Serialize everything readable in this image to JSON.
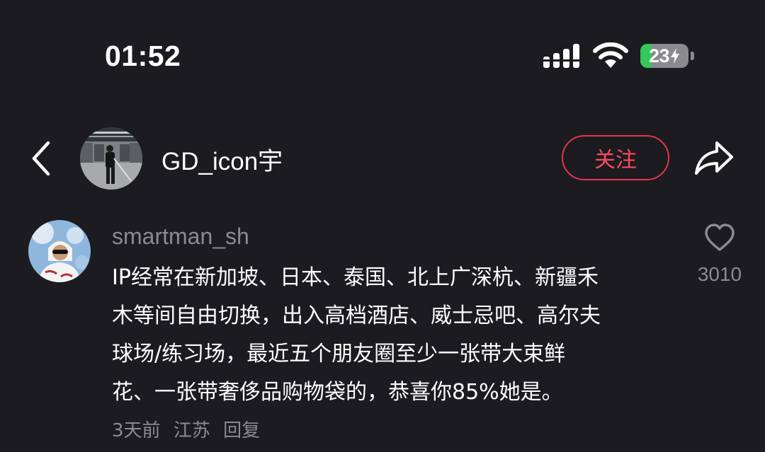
{
  "status_bar": {
    "time": "01:52",
    "battery_level": 23,
    "battery_text": "23",
    "charging": true,
    "icons": [
      "signal-icon",
      "wifi-icon",
      "battery-icon",
      "charging-bolt-icon"
    ]
  },
  "header": {
    "back_icon": "chevron-left-icon",
    "username": "GD_icon宇",
    "follow_label": "关注",
    "share_icon": "share-arrow-icon"
  },
  "comment": {
    "author": "smartman_sh",
    "text_lines": [
      "IP经常在新加坡、日本、泰国、北上广深杭、新疆禾",
      "木等间自由切换，出入高档酒店、威士忌吧、高尔夫",
      "球场/练习场，最近五个朋友圈至少一张带大束鲜",
      "花、一张带奢侈品购物袋的，恭喜你85%她是。"
    ],
    "time": "3天前",
    "location": "江苏",
    "reply_label": "回复",
    "like_icon": "heart-outline-icon",
    "like_count": "3010"
  },
  "colors": {
    "background": "#1b1b20",
    "accent": "#e8344e",
    "muted_text": "#8a8a90",
    "battery_green": "#34c759"
  }
}
